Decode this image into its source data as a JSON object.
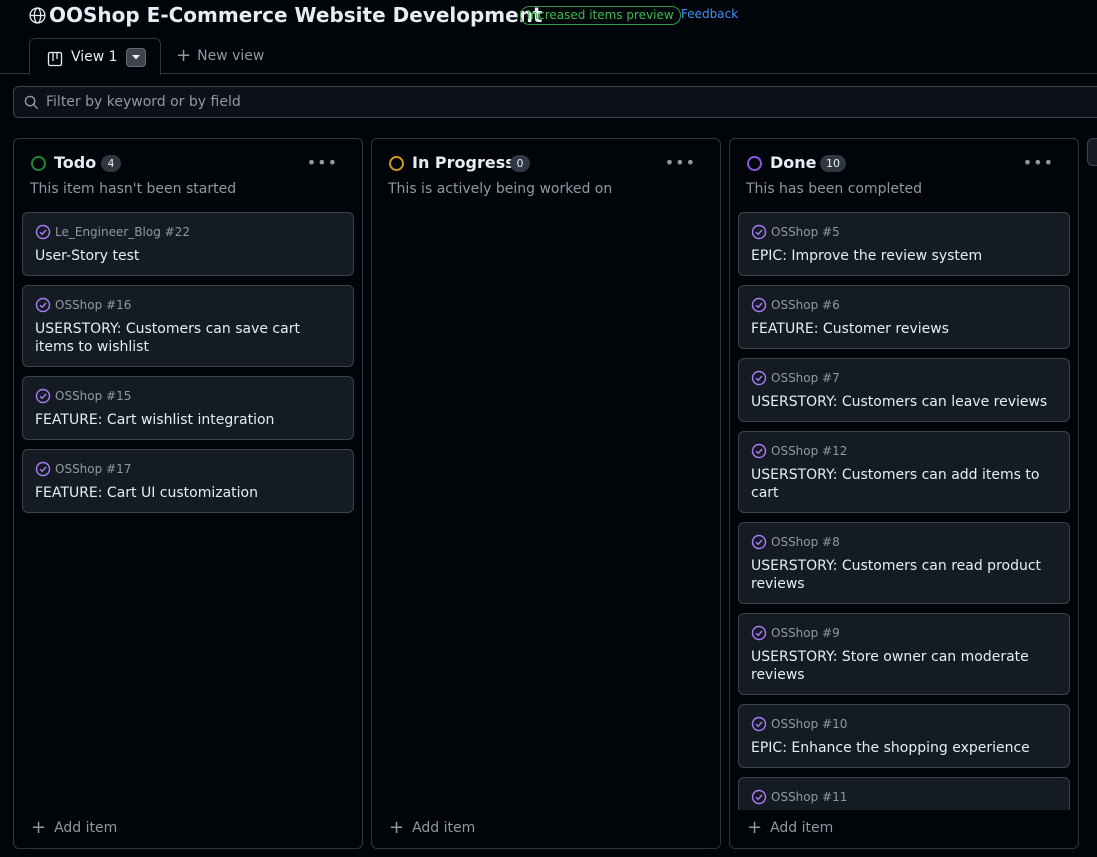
{
  "header": {
    "title": "OOShop E-Commerce Website Development",
    "badge": "Increased items preview",
    "feedback": "Feedback",
    "icon": "globe-icon"
  },
  "tabs": {
    "active_label": "View 1",
    "new_view_label": "New view"
  },
  "filter": {
    "placeholder": "Filter by keyword or by field"
  },
  "columns": [
    {
      "title": "Todo",
      "count": "4",
      "description": "This item hasn't been started",
      "status_color": "#238636",
      "add_label": "Add item",
      "cards": [
        {
          "ref": "Le_Engineer_Blog #22",
          "title": "User-Story test"
        },
        {
          "ref": "OSShop #16",
          "title": "USERSTORY: Customers can save cart items to wishlist"
        },
        {
          "ref": "OSShop #15",
          "title": "FEATURE: Cart wishlist integration"
        },
        {
          "ref": "OSShop #17",
          "title": "FEATURE: Cart UI customization"
        }
      ]
    },
    {
      "title": "In Progress",
      "count": "0",
      "description": "This is actively being worked on",
      "status_color": "#d29922",
      "add_label": "Add item",
      "cards": []
    },
    {
      "title": "Done",
      "count": "10",
      "description": "This has been completed",
      "status_color": "#8957e5",
      "add_label": "Add item",
      "cards": [
        {
          "ref": "OSShop #5",
          "title": "EPIC: Improve the review system"
        },
        {
          "ref": "OSShop #6",
          "title": "FEATURE: Customer reviews"
        },
        {
          "ref": "OSShop #7",
          "title": "USERSTORY: Customers can leave reviews"
        },
        {
          "ref": "OSShop #12",
          "title": "USERSTORY: Customers can add items to cart"
        },
        {
          "ref": "OSShop #8",
          "title": "USERSTORY: Customers can read product reviews"
        },
        {
          "ref": "OSShop #9",
          "title": "USERSTORY: Store owner can moderate reviews"
        },
        {
          "ref": "OSShop #10",
          "title": "EPIC: Enhance the shopping experience"
        },
        {
          "ref": "OSShop #11",
          "title": ""
        }
      ]
    }
  ],
  "colors": {
    "background": "#010409",
    "card": "#151b23",
    "border": "#30363d",
    "done_purple": "#ab7df8",
    "accent_blue": "#4493f8",
    "success_green": "#3fb950"
  }
}
